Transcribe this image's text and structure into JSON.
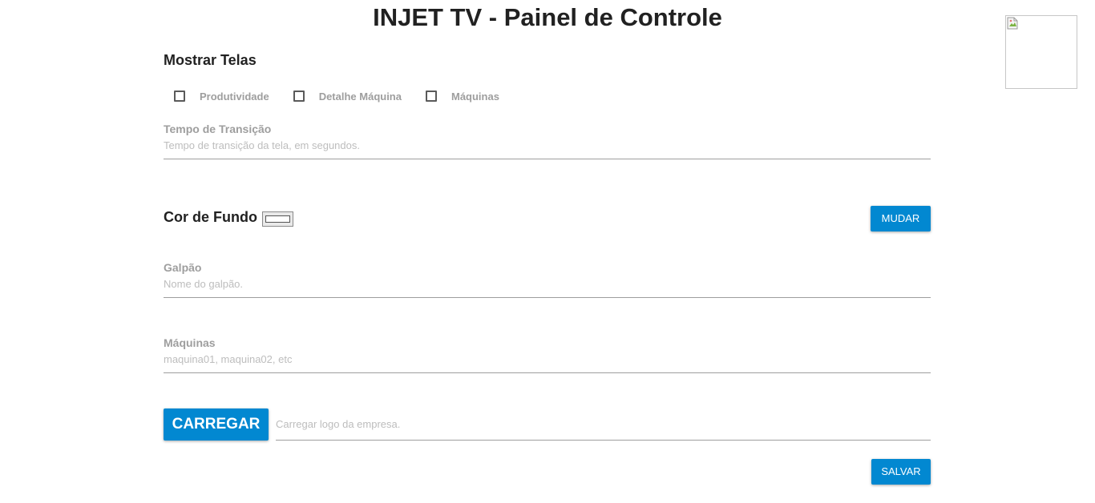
{
  "header": {
    "title": "INJET TV - Painel de Controle",
    "logo_icon": "broken-image-icon"
  },
  "screens": {
    "heading": "Mostrar Telas",
    "options": [
      {
        "label": "Produtividade",
        "checked": false
      },
      {
        "label": "Detalhe Máquina",
        "checked": false
      },
      {
        "label": "Máquinas",
        "checked": false
      }
    ]
  },
  "transition": {
    "label": "Tempo de Transição",
    "placeholder": "Tempo de transição da tela, em segundos.",
    "value": ""
  },
  "background": {
    "heading": "Cor de Fundo",
    "color": "#ffffff",
    "change_label": "MUDAR"
  },
  "warehouse": {
    "label": "Galpão",
    "placeholder": "Nome do galpão.",
    "value": ""
  },
  "machines": {
    "label": "Máquinas",
    "placeholder": "maquina01, maquina02, etc",
    "value": ""
  },
  "upload": {
    "button_label": "CARREGAR",
    "placeholder": "Carregar logo da empresa."
  },
  "actions": {
    "save_label": "SALVAR"
  },
  "colors": {
    "primary": "#0288d1",
    "label_gray": "#9e9e9e",
    "placeholder_gray": "#bdbdbd"
  }
}
